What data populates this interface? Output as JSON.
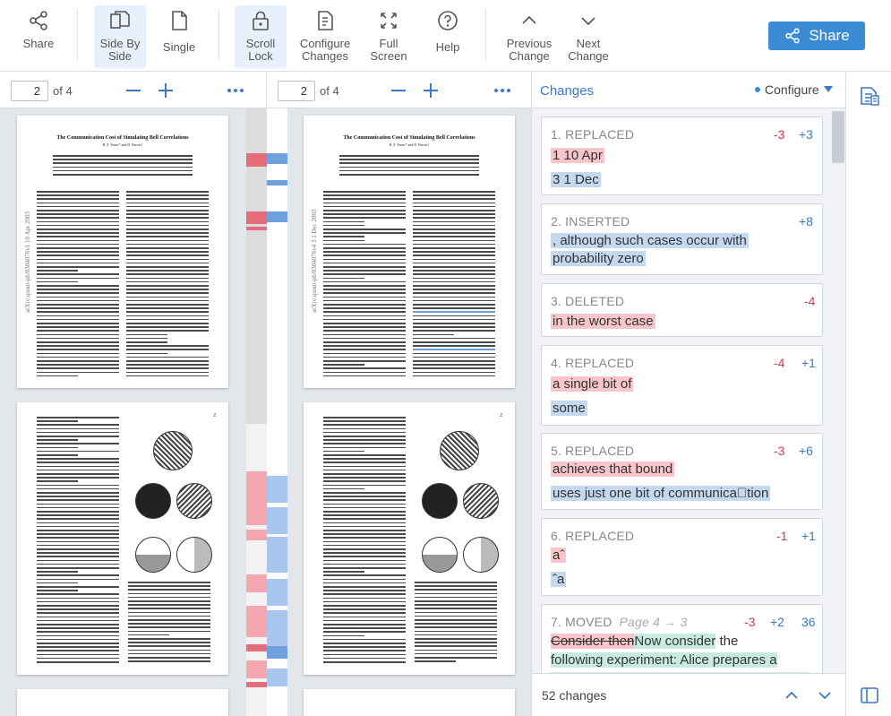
{
  "toolbar": {
    "share": "Share",
    "side_by_side": "Side By\nSide",
    "single": "Single",
    "scroll_lock": "Scroll\nLock",
    "configure_changes": "Configure\nChanges",
    "full_screen": "Full\nScreen",
    "help": "Help",
    "previous_change": "Previous\nChange",
    "next_change": "Next\nChange",
    "share_button": "Share"
  },
  "left_pane": {
    "page": "2",
    "of": "of 4"
  },
  "right_pane": {
    "page": "2",
    "of": "of 4"
  },
  "document": {
    "title": "The Communication Cost of Simulating Bell Correlations",
    "authors": "B. F. Toner* and D. Bacon†",
    "left_stamp": "arXiv:quant-ph/0304076v1  10 Apr 2003",
    "right_stamp": "arXiv:quant-ph/0304076v4  3 1 Dec 2003",
    "page_num": "2"
  },
  "changes_panel": {
    "title": "Changes",
    "configure": "Configure",
    "count": "52 changes",
    "items": [
      {
        "title": "1. REPLACED",
        "minus": "-3",
        "plus": "+3",
        "deleted": "1 10 Apr",
        "inserted": "3 1 Dec"
      },
      {
        "title": "2. INSERTED",
        "plus": "+8",
        "inserted_1": ", although such cases occur with",
        "inserted_2": "probability zero"
      },
      {
        "title": "3. DELETED",
        "minus": "-4",
        "deleted": "in the worst case"
      },
      {
        "title": "4. REPLACED",
        "minus": "-4",
        "plus": "+1",
        "deleted": "a single bit of",
        "inserted": "some"
      },
      {
        "title": "5. REPLACED",
        "minus": "-3",
        "plus": "+6",
        "deleted": "achieves that bound",
        "inserted": "uses just one bit of communica\u0000tion"
      },
      {
        "title": "6. REPLACED",
        "minus": "-1",
        "plus": "+1",
        "deleted": "aˆ",
        "inserted": "ˆa"
      },
      {
        "title": "7. MOVED",
        "moved_note": "Page 4 → 3",
        "minus": "-3",
        "plus": "+2",
        "count": "36",
        "deleted": "Consider then",
        "moved_1": "Now consider",
        "text_1": " the",
        "moved_2": "following experiment: Alice prepares a"
      }
    ]
  },
  "colors": {
    "accent": "#3a8bd4",
    "deleted": "#f7c5ca",
    "inserted": "#c4d8f0",
    "moved": "#c8ebe1"
  }
}
